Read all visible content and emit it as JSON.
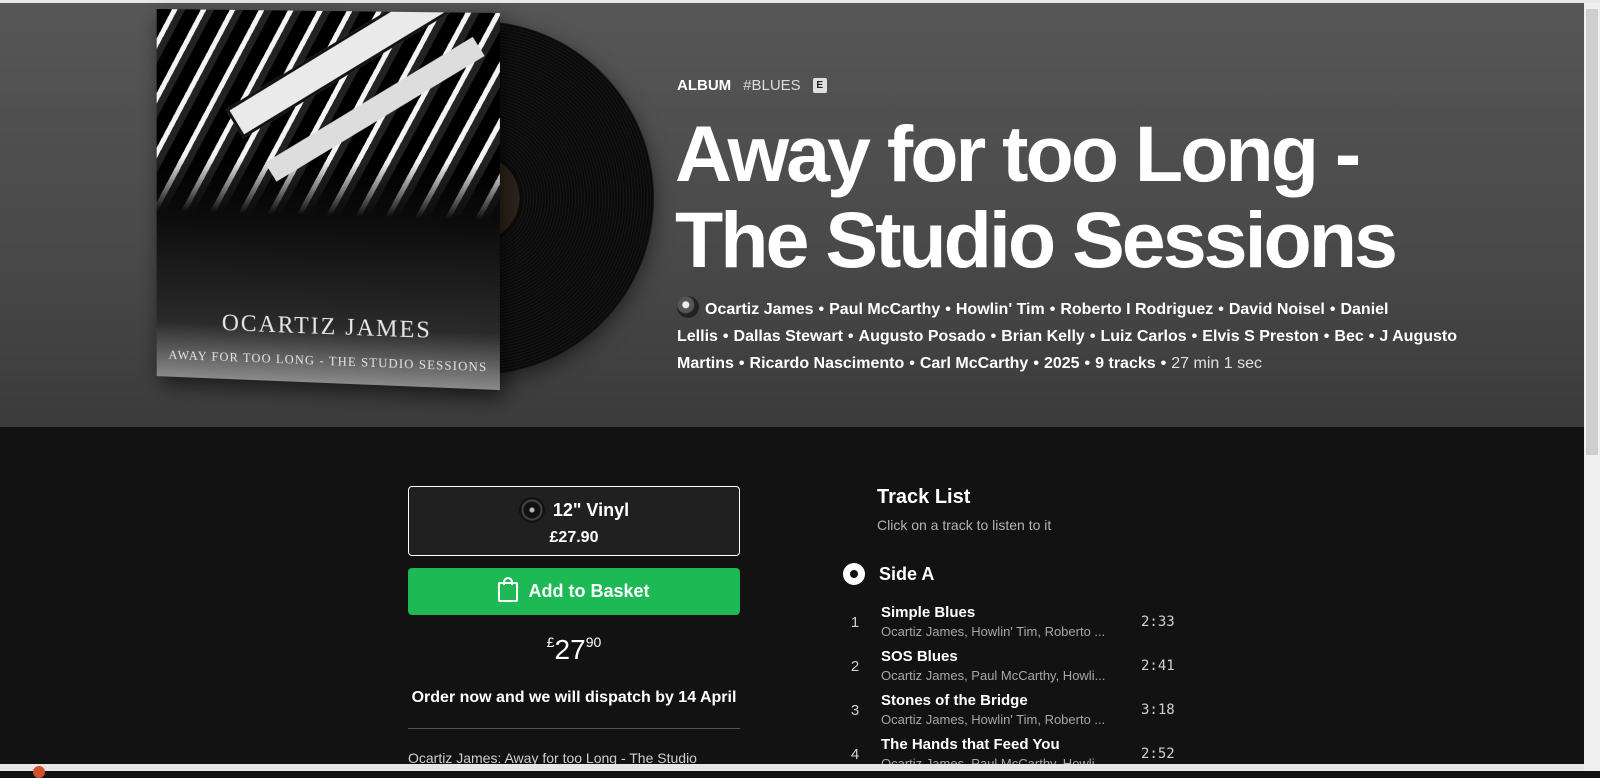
{
  "album": {
    "type_label": "ALBUM",
    "genre_tag": "#BLUES",
    "explicit_badge": "E",
    "title": "Away for too Long - The Studio Sessions",
    "cover_artist": "OCARTIZ JAMES",
    "cover_title": "AWAY FOR TOO LONG - THE STUDIO SESSIONS",
    "artists": [
      "Ocartiz James",
      "Paul McCarthy",
      "Howlin' Tim",
      "Roberto I Rodriguez",
      "David Noisel",
      "Daniel Lellis",
      "Dallas Stewart",
      "Augusto Posado",
      "Brian Kelly",
      "Luiz Carlos",
      "Elvis S Preston",
      "Bec",
      "J Augusto Martins",
      "Ricardo Nascimento",
      "Carl McCarthy"
    ],
    "year": "2025",
    "track_count": "9 tracks",
    "duration": "27 min 1 sec"
  },
  "purchase": {
    "format_name": "12\" Vinyl",
    "format_price": "£27.90",
    "add_button_label": "Add to Basket",
    "currency_symbol": "£",
    "price_pounds": "27",
    "price_pence": "90",
    "dispatch_text": "Order now and we will dispatch by 14 April",
    "description": "Ocartiz James: Away for too Long - The Studio"
  },
  "tracklist": {
    "title": "Track List",
    "subtitle": "Click on a track to listen to it",
    "side_label": "Side A",
    "tracks": [
      {
        "num": "1",
        "title": "Simple Blues",
        "artists": "Ocartiz James, Howlin' Tim, Roberto ...",
        "duration": "2:33"
      },
      {
        "num": "2",
        "title": "SOS Blues",
        "artists": "Ocartiz James, Paul McCarthy, Howli...",
        "duration": "2:41"
      },
      {
        "num": "3",
        "title": "Stones of the Bridge",
        "artists": "Ocartiz James, Howlin' Tim, Roberto ...",
        "duration": "3:18"
      },
      {
        "num": "4",
        "title": "The Hands that Feed You",
        "artists": "Ocartiz James, Paul McCarthy, Howli...",
        "duration": "2:52"
      }
    ]
  },
  "colors": {
    "accent_green": "#1db954",
    "background": "#121212"
  }
}
